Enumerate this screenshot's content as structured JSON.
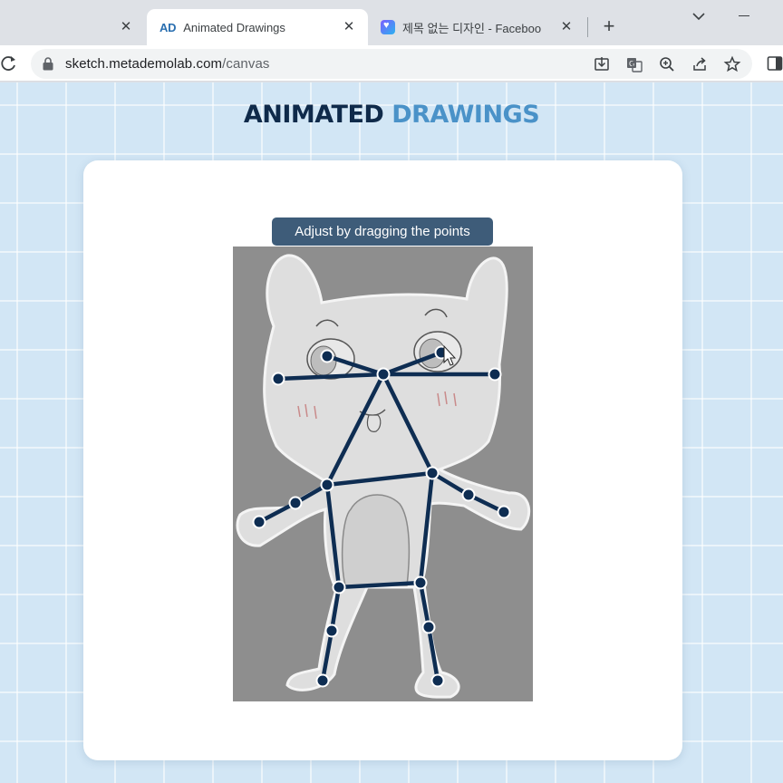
{
  "browser": {
    "tabs": [
      {
        "title": "",
        "close": "✕"
      },
      {
        "favicon": "AD",
        "title": "Animated Drawings",
        "close": "✕"
      },
      {
        "favicon": "facebook-heart",
        "title": "제목 없는 디자인 - Faceboo",
        "close": "✕"
      }
    ],
    "new_tab": "+",
    "url_host": "sketch.metademolab.com",
    "url_path": "/canvas"
  },
  "page": {
    "brand_word1": "ANIMATED",
    "brand_word2": "DRAWINGS",
    "hint": "Adjust by dragging the points"
  },
  "colors": {
    "brand_dark": "#0f2a4a",
    "brand_accent": "#4a92c8",
    "skeleton": "#0e2d52",
    "hint_bg": "#3e5c79"
  }
}
